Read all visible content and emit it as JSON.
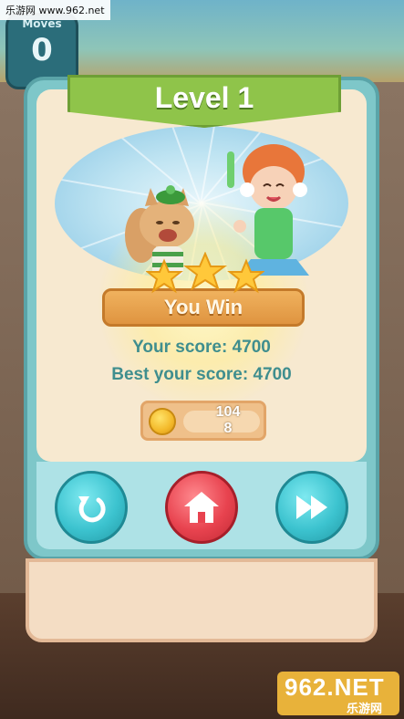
{
  "watermark": {
    "text": "乐游网 www.962.net"
  },
  "hud": {
    "moves_label": "Moves",
    "moves_value": "0"
  },
  "dialog": {
    "level_title": "Level 1",
    "stars_earned": 3,
    "stars_total": 3,
    "result_label": "You Win",
    "your_score": "Your score: 4700",
    "best_score": "Best your score: 4700",
    "coins_value_line1": "104",
    "coins_value_line2": "8",
    "buttons": {
      "replay_icon": "replay-icon",
      "home_icon": "home-icon",
      "next_icon": "fast-forward-icon"
    }
  },
  "logo": {
    "big": "962.NET",
    "small": "乐游网"
  },
  "colors": {
    "dialog_border": "#5aa4a8",
    "ribbon": "#8fc44a",
    "banner": "#df9440",
    "score_text": "#3f8e8e",
    "teal_button": "#3cc3cf",
    "red_button": "#e8434f"
  }
}
